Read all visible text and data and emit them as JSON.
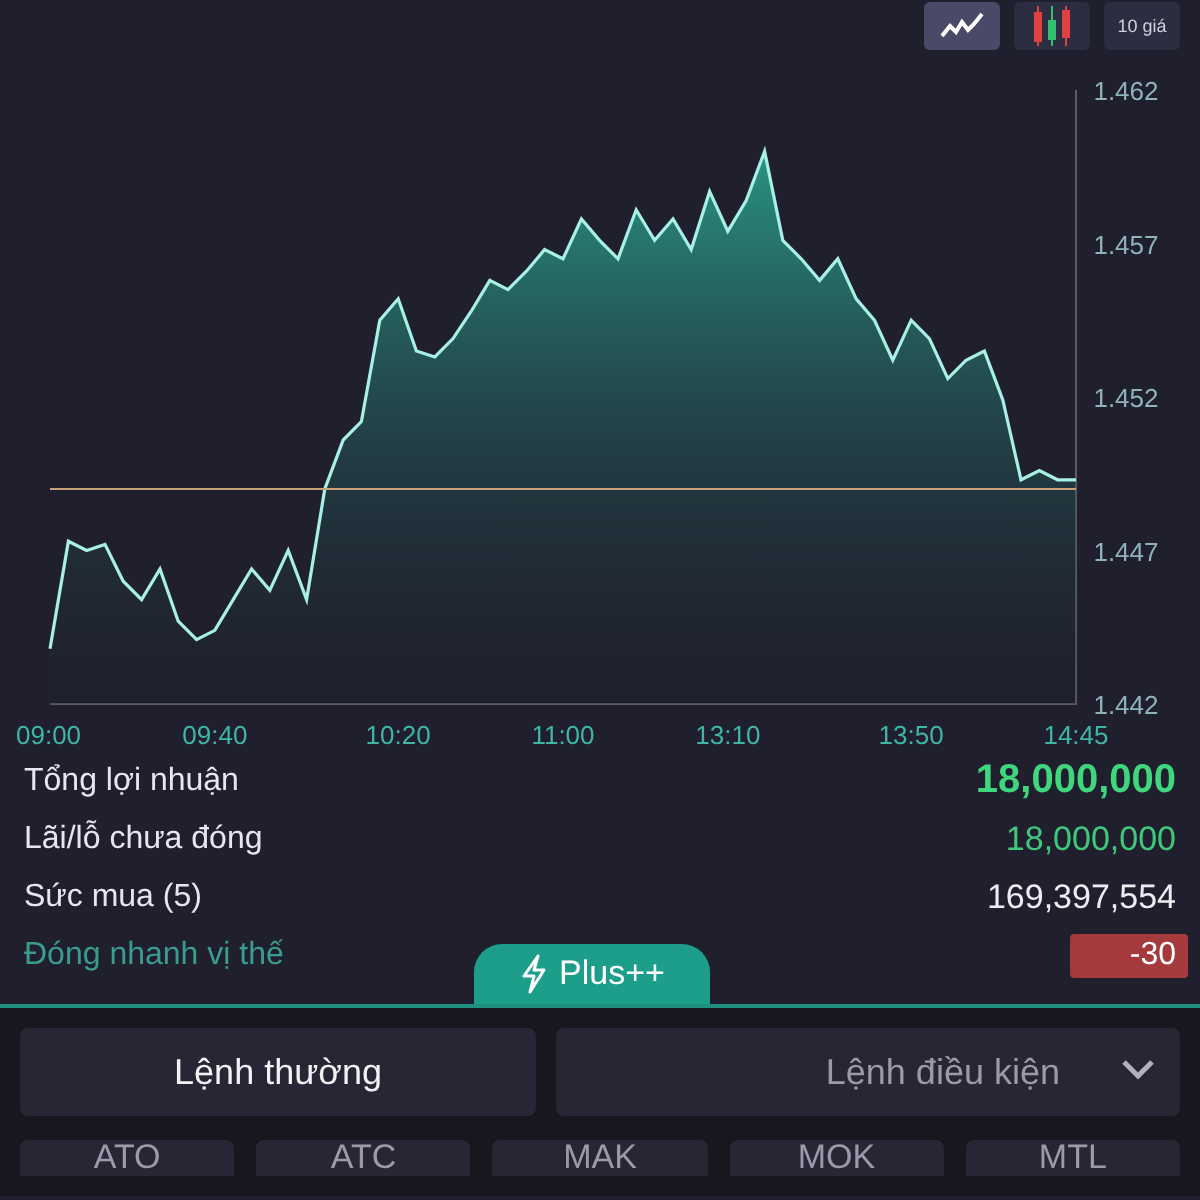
{
  "chart_toolbar": [
    {
      "kind": "line-icon",
      "selected": true
    },
    {
      "kind": "candle-icon",
      "selected": false
    },
    {
      "kind": "text",
      "label": "10 giá",
      "selected": false
    }
  ],
  "chart": {
    "chart_data": {
      "type": "area",
      "categories": [
        "09:00",
        null,
        null,
        null,
        null,
        null,
        null,
        null,
        null,
        "09:40",
        null,
        null,
        null,
        null,
        null,
        null,
        null,
        null,
        null,
        "10:20",
        null,
        null,
        null,
        null,
        null,
        null,
        null,
        null,
        "11:00",
        null,
        null,
        null,
        null,
        null,
        null,
        null,
        null,
        "13:10",
        null,
        null,
        null,
        null,
        null,
        null,
        null,
        null,
        null,
        "13:50",
        null,
        null,
        null,
        null,
        null,
        null,
        null,
        null,
        "14:45"
      ],
      "series": [
        {
          "color": "#a8f0e6",
          "values": [
            1.4438,
            1.4473,
            1.447,
            1.4472,
            1.446,
            1.4454,
            1.4464,
            1.4447,
            1.4441,
            1.4444,
            1.4454,
            1.4464,
            1.4457,
            1.447,
            1.4454,
            1.449,
            1.4506,
            1.4512,
            1.4545,
            1.4552,
            1.4535,
            1.4533,
            1.4539,
            1.4548,
            1.4558,
            1.4555,
            1.4561,
            1.4568,
            1.4565,
            1.4578,
            1.4571,
            1.4565,
            1.4581,
            1.4571,
            1.4578,
            1.4568,
            1.4587,
            1.4574,
            1.4584,
            1.46,
            1.4571,
            1.4565,
            1.4558,
            1.4565,
            1.4552,
            1.4545,
            1.4532,
            1.4545,
            1.4539,
            1.4526,
            1.4532,
            1.4535,
            1.4519,
            1.4493,
            1.4496,
            1.4493,
            1.4493
          ]
        },
        {
          "color": "#c9a27a",
          "type": "line",
          "values": [
            1.449,
            1.449,
            1.449,
            1.449,
            1.449,
            1.449,
            1.449,
            1.449,
            1.449,
            1.449,
            1.449,
            1.449,
            1.449,
            1.449,
            1.449,
            1.449,
            1.449,
            1.449,
            1.449,
            1.449,
            1.449,
            1.449,
            1.449,
            1.449,
            1.449,
            1.449,
            1.449,
            1.449,
            1.449,
            1.449,
            1.449,
            1.449,
            1.449,
            1.449,
            1.449,
            1.449,
            1.449,
            1.449,
            1.449,
            1.449,
            1.449,
            1.449,
            1.449,
            1.449,
            1.449,
            1.449,
            1.449,
            1.449,
            1.449,
            1.449,
            1.449,
            1.449,
            1.449,
            1.449,
            1.449,
            1.449,
            1.449
          ]
        }
      ],
      "ylim": [
        1.442,
        1.462
      ],
      "yticks": [
        1.442,
        1.447,
        1.452,
        1.457,
        1.462
      ]
    }
  },
  "summary": [
    {
      "kind": "total",
      "label": "Tổng lợi nhuận",
      "value": "18,000,000"
    },
    {
      "kind": "gain",
      "label": "Lãi/lỗ chưa đóng",
      "value": "18,000,000"
    },
    {
      "kind": "plain",
      "label": "Sức mua (5)",
      "value": "169,397,554"
    },
    {
      "kind": "badge",
      "label": "Đóng nhanh vị thế",
      "value": "-30"
    }
  ],
  "plus_tab": {
    "label": "Plus++"
  },
  "order_tabs": [
    {
      "label": "Lệnh thường",
      "selected": true,
      "dropdown": false
    },
    {
      "label": "Lệnh điều kiện",
      "selected": false,
      "dropdown": true
    }
  ],
  "order_types": [
    {
      "label": "ATO"
    },
    {
      "label": "ATC"
    },
    {
      "label": "MAK"
    },
    {
      "label": "MOK"
    },
    {
      "label": "MTL"
    }
  ]
}
